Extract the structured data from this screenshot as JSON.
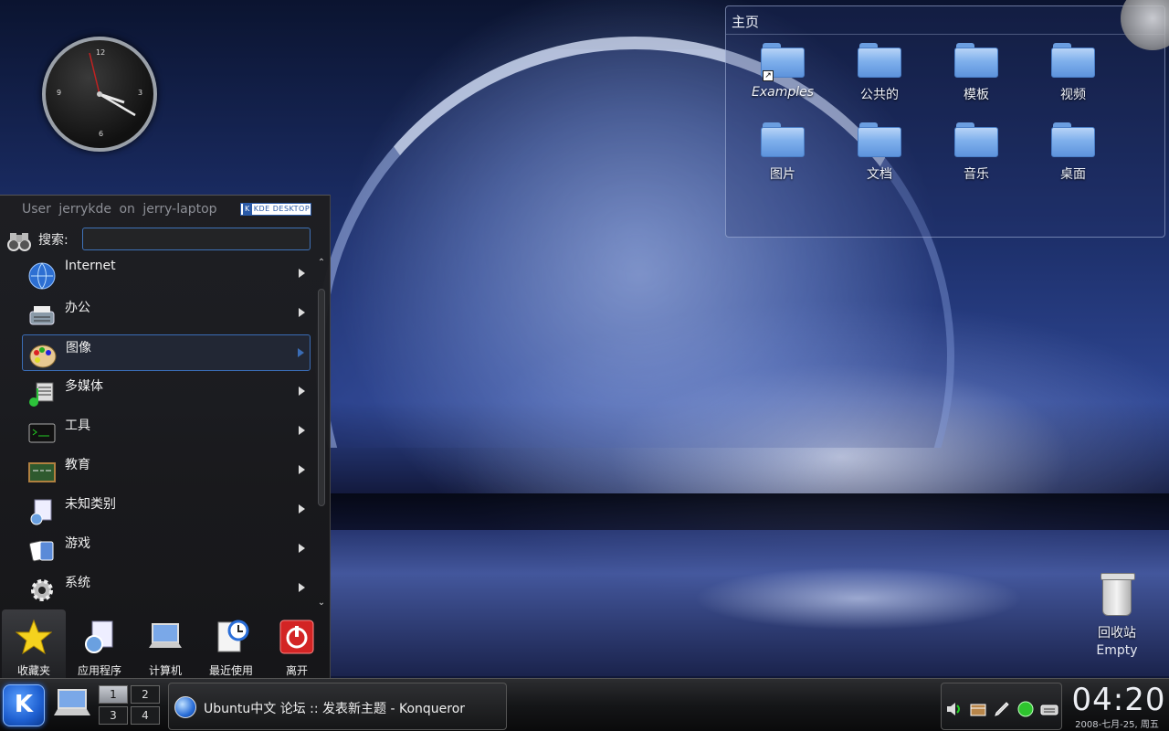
{
  "desktop": {
    "folder_view": {
      "title": "主页",
      "items": [
        {
          "label": "Examples",
          "italic": true,
          "link": true
        },
        {
          "label": "公共的"
        },
        {
          "label": "模板"
        },
        {
          "label": "视频"
        },
        {
          "label": "图片"
        },
        {
          "label": "文档"
        },
        {
          "label": "音乐"
        },
        {
          "label": "桌面"
        }
      ]
    },
    "clock": {
      "numerals": [
        "12",
        "3",
        "6",
        "9"
      ]
    },
    "trash": {
      "label": "回收站",
      "status": "Empty"
    }
  },
  "start_menu": {
    "user_line": "User jerrykde on jerry-laptop",
    "logo": {
      "k": "K",
      "text": "KDE DESKTOP"
    },
    "search": {
      "label": "搜索:",
      "value": "",
      "placeholder": ""
    },
    "items": [
      {
        "label": "Internet",
        "icon": "globe-icon"
      },
      {
        "label": "办公",
        "icon": "typewriter-icon"
      },
      {
        "label": "图像",
        "icon": "palette-icon",
        "active": true
      },
      {
        "label": "多媒体",
        "icon": "music-icon"
      },
      {
        "label": "工具",
        "icon": "terminal-icon"
      },
      {
        "label": "教育",
        "icon": "chalkboard-icon"
      },
      {
        "label": "未知类别",
        "icon": "unknown-icon"
      },
      {
        "label": "游戏",
        "icon": "cards-icon"
      },
      {
        "label": "系统",
        "icon": "gear-icon"
      }
    ],
    "tabs": [
      {
        "label": "收藏夹",
        "icon": "star-icon",
        "selected": true
      },
      {
        "label": "应用程序",
        "icon": "applications-icon"
      },
      {
        "label": "计算机",
        "icon": "computer-icon"
      },
      {
        "label": "最近使用",
        "icon": "recent-icon"
      },
      {
        "label": "离开",
        "icon": "power-icon"
      }
    ]
  },
  "taskbar": {
    "k_label": "K",
    "pager": [
      "1",
      "2",
      "3",
      "4"
    ],
    "active_desktop": "1",
    "task": {
      "label": "Ubuntu中文 论坛 :: 发表新主题 - Konqueror"
    },
    "tray": [
      "volume-icon",
      "package-icon",
      "pen-icon",
      "network-icon",
      "keyboard-icon"
    ],
    "time": "04:20",
    "date": "2008-七月-25, 周五"
  }
}
